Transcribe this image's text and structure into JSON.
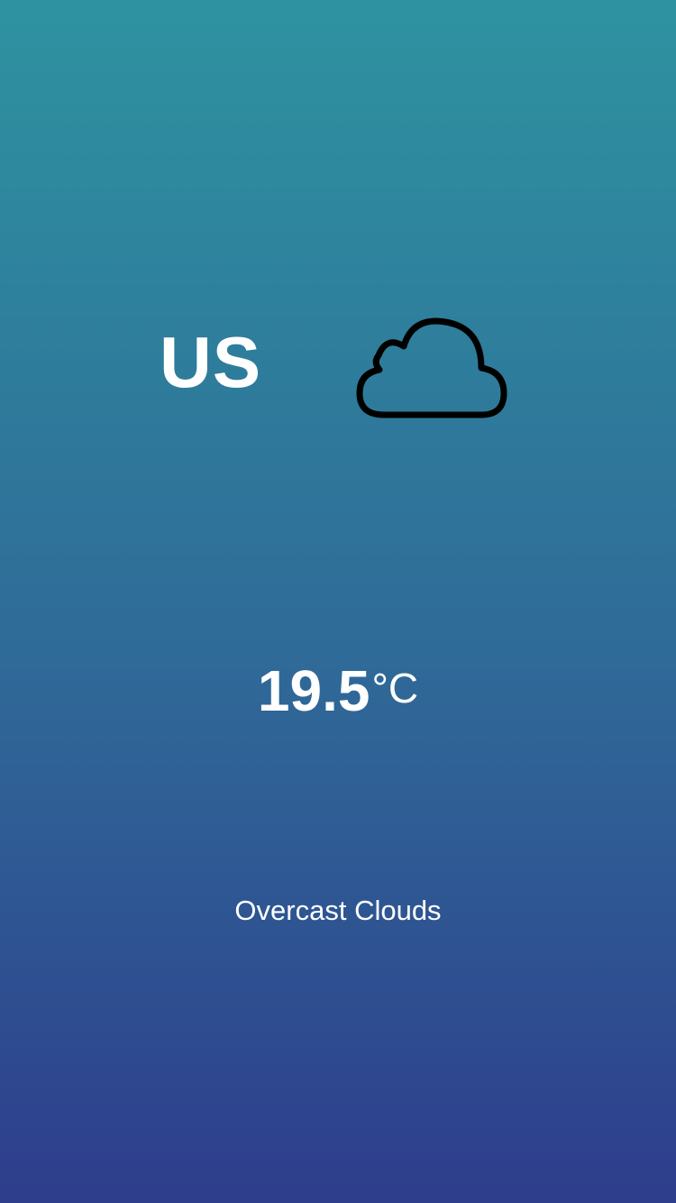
{
  "location": {
    "country": "US"
  },
  "weather": {
    "icon": "cloud-icon",
    "temperature": "19.5",
    "unit": "°C",
    "description": "Overcast Clouds"
  },
  "colors": {
    "gradient_top": "#2e93a0",
    "gradient_bottom": "#2e3d8c",
    "text": "#ffffff",
    "icon_stroke": "#000000"
  }
}
